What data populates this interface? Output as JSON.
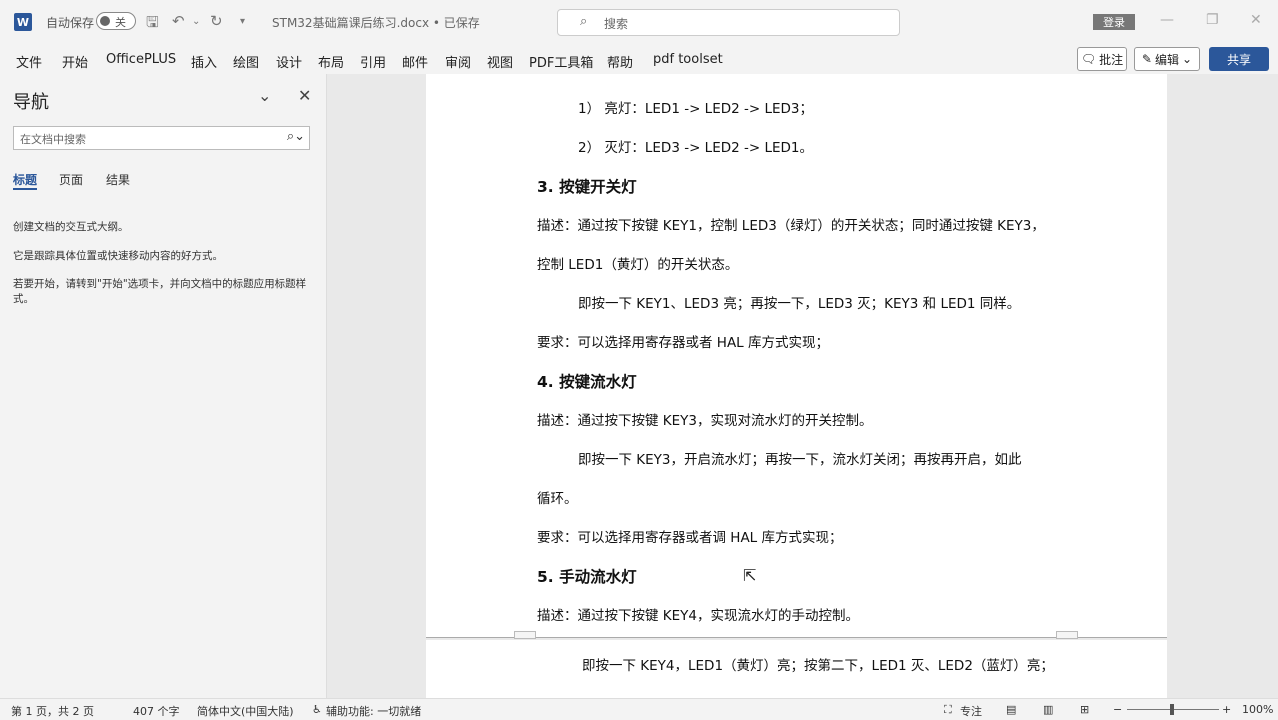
{
  "titlebar": {
    "app_logo": "W",
    "autosave_label": "自动保存",
    "toggle_state": "关",
    "doc_name": "STM32基础篇课后练习.docx • 已保存",
    "search_placeholder": "搜索",
    "login_label": "登录"
  },
  "menu": {
    "items": [
      "文件",
      "开始",
      "OfficePLUS",
      "插入",
      "绘图",
      "设计",
      "布局",
      "引用",
      "邮件",
      "审阅",
      "视图",
      "PDF工具箱",
      "帮助",
      "pdf toolset"
    ],
    "comment_label": "批注",
    "edit_label": "编辑",
    "share_label": "共享"
  },
  "nav": {
    "title": "导航",
    "search_placeholder": "在文档中搜索",
    "tabs": [
      "标题",
      "页面",
      "结果"
    ],
    "hint1": "创建文档的交互式大纲。",
    "hint2": "它是跟踪具体位置或快速移动内容的好方式。",
    "hint3": "若要开始，请转到\"开始\"选项卡，并向文档中的标题应用标题样式。"
  },
  "doc": {
    "l1": "1） 亮灯：LED1 -> LED2 -> LED3；",
    "l2": "2） 灭灯：LED3 -> LED2 -> LED1。",
    "h3": "3.  按键开关灯",
    "p3a": "描述：通过按下按键  KEY1，控制  LED3（绿灯）的开关状态；同时通过按键  KEY3，",
    "p3b": "控制 LED1（黄灯）的开关状态。",
    "p3c": "即按一下  KEY1、LED3  亮；再按一下，LED3  灭；KEY3 和 LED1 同样。",
    "p3d": "要求：可以选择用寄存器或者 HAL 库方式实现；",
    "h4": "4.  按键流水灯",
    "p4a": "描述：通过按下按键  KEY3，实现对流水灯的开关控制。",
    "p4b": "即按一下  KEY3，开启流水灯；再按一下，流水灯关闭；再按再开启，如此",
    "p4c": "循环。",
    "p4d": "要求：可以选择用寄存器或者调  HAL  库方式实现；",
    "h5": "5.  手动流水灯",
    "p5a": "描述：通过按下按键  KEY4，实现流水灯的手动控制。",
    "p5b": "即按一下 KEY4，LED1（黄灯）亮；按第二下，LED1 灭、LED2（蓝灯）亮；"
  },
  "status": {
    "page": "第 1 页，共 2 页",
    "words": "407 个字",
    "lang": "简体中文(中国大陆)",
    "accessibility": "辅助功能: 一切就绪",
    "focus": "专注",
    "zoom": "100%"
  }
}
